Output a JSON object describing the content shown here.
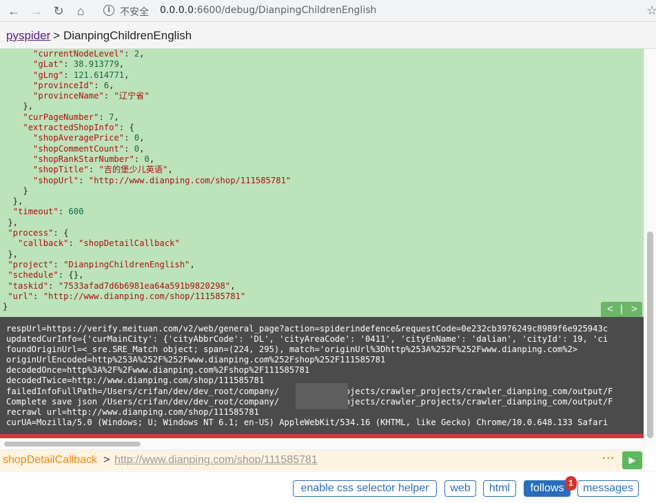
{
  "browser": {
    "back_icon": "arrow-left-icon",
    "forward_icon": "arrow-right-icon",
    "reload_icon": "reload-icon",
    "home_icon": "home-icon",
    "security_label": "不安全",
    "url_host": "0.0.0.0",
    "url_rest": ":6600/debug/DianpingChildrenEnglish",
    "bookmark_icon": "star-icon"
  },
  "header": {
    "brand": "pyspider",
    "separator": ">",
    "project": "DianpingChildrenEnglish"
  },
  "json_lines": [
    [
      [
        "      ",
        ""
      ],
      [
        "\"currentNodeLevel\"",
        "k"
      ],
      [
        ": ",
        ""
      ],
      [
        "2",
        "n"
      ],
      [
        ",",
        ""
      ]
    ],
    [
      [
        "      ",
        ""
      ],
      [
        "\"gLat\"",
        "k"
      ],
      [
        ": ",
        ""
      ],
      [
        "38.913779",
        "n"
      ],
      [
        ",",
        ""
      ]
    ],
    [
      [
        "      ",
        ""
      ],
      [
        "\"gLng\"",
        "k"
      ],
      [
        ": ",
        ""
      ],
      [
        "121.614771",
        "n"
      ],
      [
        ",",
        ""
      ]
    ],
    [
      [
        "      ",
        ""
      ],
      [
        "\"provinceId\"",
        "k"
      ],
      [
        ": ",
        ""
      ],
      [
        "6",
        "n"
      ],
      [
        ",",
        ""
      ]
    ],
    [
      [
        "      ",
        ""
      ],
      [
        "\"provinceName\"",
        "k"
      ],
      [
        ": ",
        ""
      ],
      [
        "\"辽宁省\"",
        "s"
      ]
    ],
    [
      [
        "    },",
        ""
      ]
    ],
    [
      [
        "    ",
        ""
      ],
      [
        "\"curPageNumber\"",
        "k"
      ],
      [
        ": ",
        ""
      ],
      [
        "7",
        "n"
      ],
      [
        ",",
        ""
      ]
    ],
    [
      [
        "    ",
        ""
      ],
      [
        "\"extractedShopInfo\"",
        "k"
      ],
      [
        ": {",
        ""
      ]
    ],
    [
      [
        "      ",
        ""
      ],
      [
        "\"shopAveragePrice\"",
        "k"
      ],
      [
        ": ",
        ""
      ],
      [
        "0",
        "n"
      ],
      [
        ",",
        ""
      ]
    ],
    [
      [
        "      ",
        ""
      ],
      [
        "\"shopCommentCount\"",
        "k"
      ],
      [
        ": ",
        ""
      ],
      [
        "0",
        "n"
      ],
      [
        ",",
        ""
      ]
    ],
    [
      [
        "      ",
        ""
      ],
      [
        "\"shopRankStarNumber\"",
        "k"
      ],
      [
        ": ",
        ""
      ],
      [
        "0",
        "n"
      ],
      [
        ",",
        ""
      ]
    ],
    [
      [
        "      ",
        ""
      ],
      [
        "\"shopTitle\"",
        "k"
      ],
      [
        ": ",
        ""
      ],
      [
        "\"吉的堡少儿英语\"",
        "s"
      ],
      [
        ",",
        ""
      ]
    ],
    [
      [
        "      ",
        ""
      ],
      [
        "\"shopUrl\"",
        "k"
      ],
      [
        ": ",
        ""
      ],
      [
        "\"http://www.dianping.com/shop/111585781\"",
        "s"
      ]
    ],
    [
      [
        "    }",
        ""
      ]
    ],
    [
      [
        "  },",
        ""
      ]
    ],
    [
      [
        "  ",
        ""
      ],
      [
        "\"timeout\"",
        "k"
      ],
      [
        ": ",
        ""
      ],
      [
        "600",
        "n"
      ]
    ],
    [
      [
        " },",
        ""
      ]
    ],
    [
      [
        " ",
        ""
      ],
      [
        "\"process\"",
        "k"
      ],
      [
        ": {",
        ""
      ]
    ],
    [
      [
        "   ",
        ""
      ],
      [
        "\"callback\"",
        "k"
      ],
      [
        ": ",
        ""
      ],
      [
        "\"shopDetailCallback\"",
        "s"
      ]
    ],
    [
      [
        " },",
        ""
      ]
    ],
    [
      [
        " ",
        ""
      ],
      [
        "\"project\"",
        "k"
      ],
      [
        ": ",
        ""
      ],
      [
        "\"DianpingChildrenEnglish\"",
        "s"
      ],
      [
        ",",
        ""
      ]
    ],
    [
      [
        " ",
        ""
      ],
      [
        "\"schedule\"",
        "k"
      ],
      [
        ": {},",
        ""
      ]
    ],
    [
      [
        " ",
        ""
      ],
      [
        "\"taskid\"",
        "k"
      ],
      [
        ": ",
        ""
      ],
      [
        "\"7533afad7d6b6981ea64a591b9820298\"",
        "s"
      ],
      [
        ",",
        ""
      ]
    ],
    [
      [
        " ",
        ""
      ],
      [
        "\"url\"",
        "k"
      ],
      [
        ": ",
        ""
      ],
      [
        "\"http://www.dianping.com/shop/111585781\"",
        "s"
      ]
    ],
    [
      [
        "}",
        ""
      ]
    ]
  ],
  "pager": {
    "prev": "<",
    "divider": "|",
    "next": ">"
  },
  "console_lines": [
    "respUrl=https://verify.meituan.com/v2/web/general_page?action=spiderindefence&requestCode=0e232cb3976249c8989f6e925943c",
    "updatedCurInfo={'curMainCity': {'cityAbbrCode': 'DL', 'cityAreaCode': '0411', 'cityEnName': 'dalian', 'cityId': 19, 'ci",
    "foundOriginUrl=<_sre.SRE_Match object; span=(224, 295), match='originUrl%3Dhttp%253A%252F%252Fwww.dianping.com%2>",
    "originUrlEncoded=http%253A%252F%252Fwww.dianping.com%252Fshop%252F111585781",
    "decodedOnce=http%3A%2F%2Fwww.dianping.com%2Fshop%2F111585781",
    "decodedTwice=http://www.dianping.com/shop/111585781",
    "failedInfoFullPath=/Users/crifan/dev/dev_root/company/          /projects/crawler_projects/crawler_dianping_com/output/F",
    "Complete save json /Users/crifan/dev/dev_root/company/          /projects/crawler_projects/crawler_dianping_com/output/F",
    "recrawl url=http://www.dianping.com/shop/111585781",
    "curUA=Mozilla/5.0 (Windows; U; Windows NT 6.1; en-US) AppleWebKit/534.16 (KHTML, like Gecko) Chrome/10.0.648.133 Safari"
  ],
  "callback_bar": {
    "callback": "shopDetailCallback",
    "separator": ">",
    "url": "http://www.dianping.com/shop/111585781",
    "more": "···",
    "run_icon": "play-icon"
  },
  "tabs": {
    "css_helper": "enable css selector helper",
    "web": "web",
    "html": "html",
    "follows": "follows",
    "follows_count": "1",
    "messages": "messages"
  },
  "colors": {
    "json_bg": "#bde3bb",
    "console_bg": "#4b4b4b",
    "accent": "#2a6ebb",
    "callback": "#e88a14",
    "run": "#5cb85c"
  }
}
